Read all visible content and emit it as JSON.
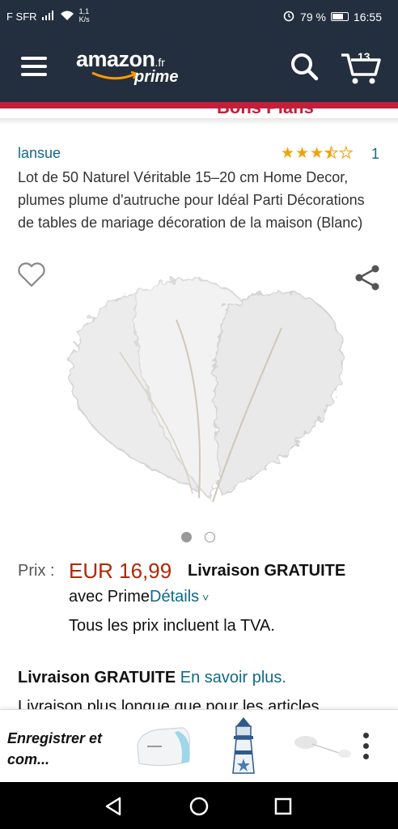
{
  "status_bar": {
    "carrier": "F SFR",
    "speed": "1,1\nK/s",
    "battery": "79 %",
    "time": "16:55",
    "battery_level": 0.79
  },
  "header": {
    "logo_word": "amazon",
    "logo_tld": ".fr",
    "logo_prime": "prime",
    "cart_count": "13"
  },
  "banner": {
    "text": "Bons Plans",
    "color": "#c41e3a"
  },
  "product": {
    "brand": "lansue",
    "rating": 3.5,
    "rating_max": 5,
    "review_count": "1",
    "title": "Lot de 50 Naturel Véritable 15–20 cm Home Decor, plumes plume d'autruche pour Idéal Parti Décorations de tables de mariage décoration de la maison (Blanc)",
    "image_count": 2,
    "image_active": 1
  },
  "price": {
    "label": "Prix :",
    "value": "EUR 16,99",
    "delivery": "Livraison GRATUITE",
    "prime_text": "avec Prime",
    "details_link": "Détails",
    "tax_note": "Tous les prix incluent la TVA."
  },
  "shipping": {
    "bold": "Livraison GRATUITE",
    "link": "En savoir plus.",
    "cut_line": "Livraison plus longue que pour les articles"
  },
  "bottom_bar": {
    "save_label": "Enregistrer et com..."
  },
  "colors": {
    "header_bg": "#232f3e",
    "link": "#0f6a8b",
    "price": "#b12704",
    "star": "#f0a30a"
  }
}
